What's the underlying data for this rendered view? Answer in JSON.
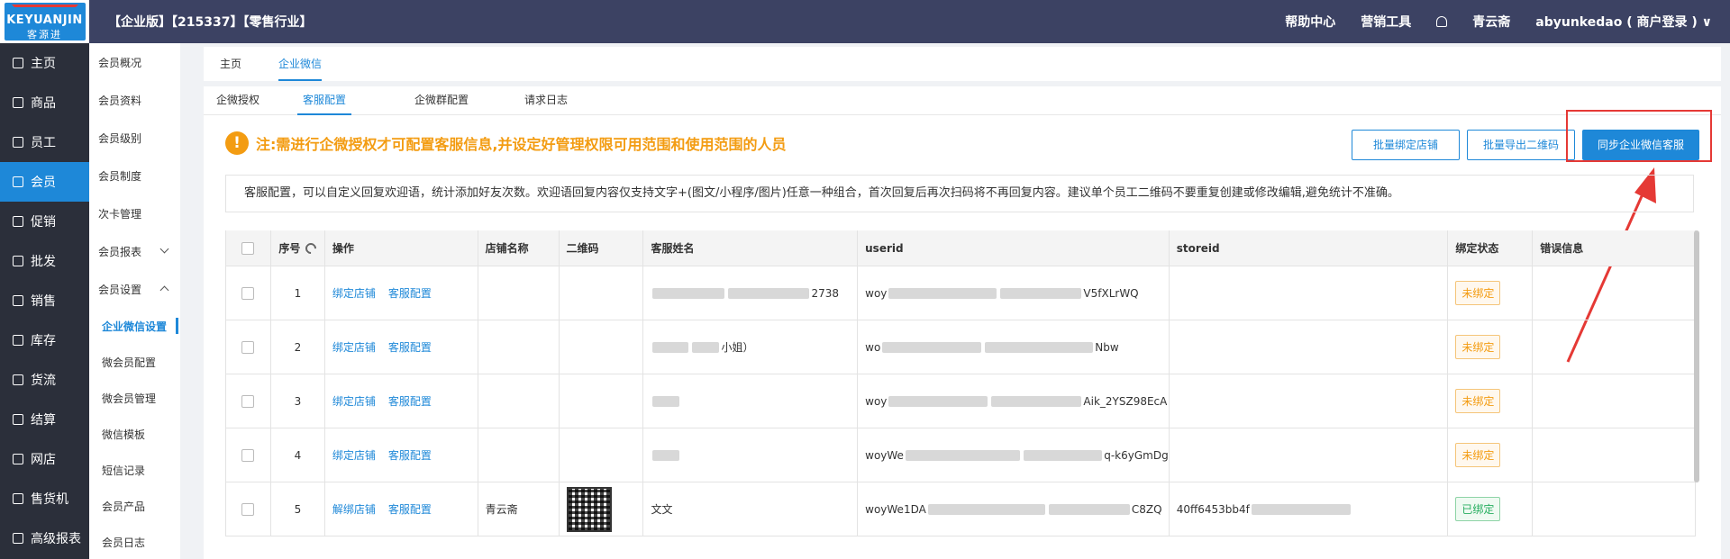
{
  "top": {
    "logo_en": "KEYUANJIN",
    "logo_cn": "客源进",
    "title": "【企业版】【215337】【零售行业】",
    "help": "帮助中心",
    "marketing": "营销工具",
    "store": "青云斋",
    "user": "abyunkedao ( 商户登录 ) ∨"
  },
  "leftnav": [
    {
      "label": "主页",
      "active": false
    },
    {
      "label": "商品",
      "active": false
    },
    {
      "label": "员工",
      "active": false
    },
    {
      "label": "会员",
      "active": true
    },
    {
      "label": "促销",
      "active": false
    },
    {
      "label": "批发",
      "active": false
    },
    {
      "label": "销售",
      "active": false
    },
    {
      "label": "库存",
      "active": false
    },
    {
      "label": "货流",
      "active": false
    },
    {
      "label": "结算",
      "active": false
    },
    {
      "label": "网店",
      "active": false
    },
    {
      "label": "售货机",
      "active": false
    },
    {
      "label": "高级报表",
      "active": false
    }
  ],
  "subnav": {
    "items": [
      "会员概况",
      "会员资料",
      "会员级别",
      "会员制度",
      "次卡管理",
      "会员报表",
      "会员设置"
    ],
    "children": [
      "企业微信设置",
      "微会员配置",
      "微会员管理",
      "微信模板",
      "短信记录",
      "会员产品",
      "会员日志"
    ]
  },
  "tabs1": [
    "主页",
    "企业微信"
  ],
  "tabs2": [
    "企微授权",
    "客服配置",
    "企微群配置",
    "请求日志"
  ],
  "warning": "注:需进行企微授权才可配置客服信息,并设定好管理权限可用范围和使用范围的人员",
  "buttons": {
    "bind_store": "批量绑定店铺",
    "export_qr": "批量导出二维码",
    "sync": "同步企业微信客服"
  },
  "description": "客服配置，可以自定义回复欢迎语，统计添加好友次数。欢迎语回复内容仅支持文字+(图文/小程序/图片)任意一种组合，首次回复后再次扫码将不再回复内容。建议单个员工二维码不要重复创建或修改编辑,避免统计不准确。",
  "table": {
    "headers": [
      "序号",
      "操作",
      "店铺名称",
      "二维码",
      "客服姓名",
      "userid",
      "storeid",
      "绑定状态",
      "错误信息"
    ],
    "rows": [
      {
        "no": "1",
        "op1": "绑定店铺",
        "op2": "客服配置",
        "store": "",
        "name": "2738",
        "userid_a": "woy",
        "userid_b": "V5fXLrWQ",
        "storeid": "",
        "status": "未绑定",
        "bound": false
      },
      {
        "no": "2",
        "op1": "绑定店铺",
        "op2": "客服配置",
        "store": "",
        "name": "小姐）",
        "userid_a": "wo",
        "userid_b": "Nbw",
        "storeid": "",
        "status": "未绑定",
        "bound": false
      },
      {
        "no": "3",
        "op1": "绑定店铺",
        "op2": "客服配置",
        "store": "",
        "name": "",
        "userid_a": "woy",
        "userid_b": "Aik_2YSZ98EcA",
        "storeid": "",
        "status": "未绑定",
        "bound": false
      },
      {
        "no": "4",
        "op1": "绑定店铺",
        "op2": "客服配置",
        "store": "",
        "name": "",
        "userid_a": "woyWe",
        "userid_b": "q-k6yGmDg",
        "storeid": "",
        "status": "未绑定",
        "bound": false
      },
      {
        "no": "5",
        "op1": "解绑店铺",
        "op2": "客服配置",
        "store": "青云斋",
        "name": "文文",
        "userid_a": "woyWe1DA",
        "userid_b": "C8ZQ",
        "storeid": "40ff6453bb4f",
        "status": "已绑定",
        "bound": true
      }
    ]
  },
  "colors": {
    "accent": "#1e88d8",
    "topbar": "#3c4263",
    "nav": "#2b2f3a",
    "warn": "#f39c12",
    "highlight": "#e53935"
  }
}
